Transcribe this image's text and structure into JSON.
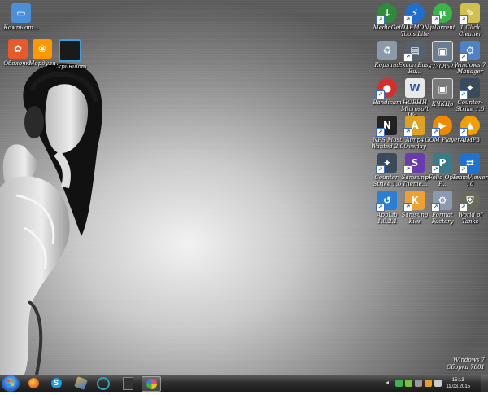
{
  "desktop": {
    "left_icons": [
      {
        "label": "Компьют...",
        "icon": "computer-icon",
        "color": "#4a90d9"
      },
      {
        "label": "Оболочка",
        "icon": "colorful-app-icon",
        "color": "#e85a2a"
      },
      {
        "label": "Мордуля",
        "icon": "picasa-icon",
        "color": "#ff9800"
      },
      {
        "label": "Скриншот",
        "icon": "screenshot-icon",
        "color": "#3aa0e0"
      }
    ],
    "right_icons": [
      {
        "label": "MediaGet",
        "icon": "mediaget-icon",
        "color": "#2e8b3a"
      },
      {
        "label": "DAEMON Tools Lite",
        "icon": "daemon-tools-icon",
        "color": "#1e6fd0"
      },
      {
        "label": "µTorrent",
        "icon": "utorrent-icon",
        "color": "#3bb54a"
      },
      {
        "label": "1 Click Cleaner",
        "icon": "cleaner-icon",
        "color": "#d0c050"
      },
      {
        "label": "Корзина",
        "icon": "recycle-bin-icon",
        "color": "#8a9aa8"
      },
      {
        "label": "Excon Easy Bu...",
        "icon": "excon-icon",
        "color": "#556070"
      },
      {
        "label": "S7308523",
        "icon": "photo-icon",
        "color": "#6a7c8e"
      },
      {
        "label": "Windows 7 Manager",
        "icon": "windows-manager-icon",
        "color": "#4d82c9"
      },
      {
        "label": "Bandicam",
        "icon": "bandicam-icon",
        "color": "#d32f2f"
      },
      {
        "label": "НОВЫЙ Microsoft Wo...",
        "icon": "word-doc-icon",
        "color": "#e8e8e8"
      },
      {
        "label": "КЧКЦв",
        "icon": "photo-icon",
        "color": "#7a7a7a"
      },
      {
        "label": "Counter-Strike 1.6",
        "icon": "counter-strike-icon",
        "color": "#3a4a5a"
      },
      {
        "label": "NFS Most Wanted 2.0",
        "icon": "nfs-icon",
        "color": "#222222"
      },
      {
        "label": "Aimp4 Overlay",
        "icon": "aimp-overlay-icon",
        "color": "#e0a020"
      },
      {
        "label": "GOM Player",
        "icon": "gom-player-icon",
        "color": "#f08a00"
      },
      {
        "label": "AIMP3",
        "icon": "aimp-icon",
        "color": "#f0a000"
      },
      {
        "label": "Counter-Strike 1.6",
        "icon": "counter-strike-icon",
        "color": "#3a4a5a"
      },
      {
        "label": "Samsung Theme...",
        "icon": "samsung-theme-icon",
        "color": "#6a3ab0"
      },
      {
        "label": "pFolio Open P...",
        "icon": "pfolio-icon",
        "color": "#3a7a8a"
      },
      {
        "label": "TeamViewer 10",
        "icon": "teamviewer-icon",
        "color": "#1e73d0"
      },
      {
        "label": "AppLib 1.0.2.1",
        "icon": "applib-icon",
        "color": "#2a7fd4"
      },
      {
        "label": "Samsung Kies",
        "icon": "samsung-kies-icon",
        "color": "#f0a030"
      },
      {
        "label": "Format Factory",
        "icon": "format-factory-icon",
        "color": "#8a9ab0"
      },
      {
        "label": "World of Tanks",
        "icon": "world-of-tanks-icon",
        "color": "#6a6a5a"
      }
    ],
    "watermark_line1": "Windows 7",
    "watermark_line2": "Сборка 7601"
  },
  "taskbar": {
    "items": [
      {
        "icon": "firefox-icon",
        "color": "#e06020",
        "active": false
      },
      {
        "icon": "skype-icon",
        "color": "#1aa0e0",
        "active": false
      },
      {
        "icon": "paint-icon",
        "color": "#d0b040",
        "active": false
      },
      {
        "icon": "media-app-icon",
        "color": "#30a0c0",
        "active": false
      },
      {
        "icon": "game-app-icon",
        "color": "#333333",
        "active": false
      },
      {
        "icon": "picasa-icon",
        "color": "#e84a7a",
        "active": true
      }
    ],
    "clock_time": "15:13",
    "clock_date": "11.03.2015"
  }
}
